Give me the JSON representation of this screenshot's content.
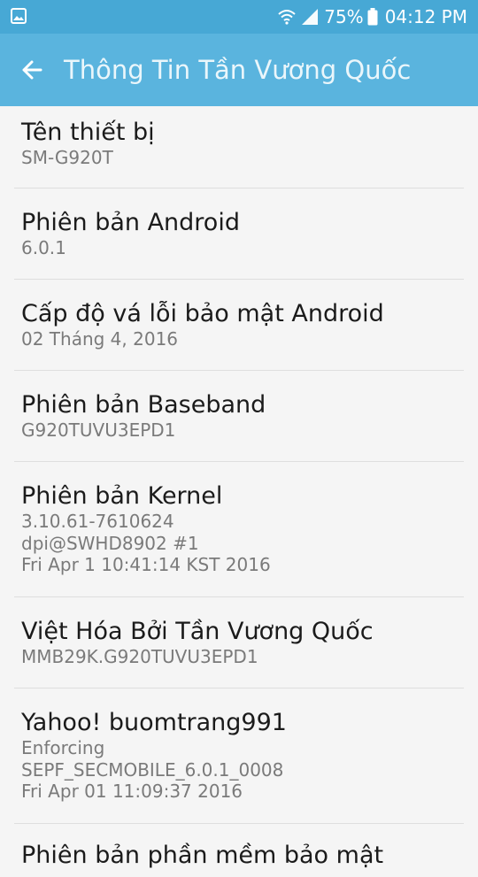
{
  "status_bar": {
    "battery": "75%",
    "time": "04:12 PM",
    "icons": [
      "image-icon",
      "wifi-icon",
      "signal-icon",
      "battery-icon"
    ]
  },
  "app_bar": {
    "title": "Thông Tin Tần Vương Quốc",
    "back_icon": "arrow-left-icon"
  },
  "items": [
    {
      "title": "Tên thiết bị",
      "subs": [
        "SM-G920T"
      ]
    },
    {
      "title": "Phiên bản Android",
      "subs": [
        "6.0.1"
      ]
    },
    {
      "title": "Cấp độ vá lỗi bảo mật Android",
      "subs": [
        "02 Tháng 4, 2016"
      ]
    },
    {
      "title": "Phiên bản Baseband",
      "subs": [
        "G920TUVU3EPD1"
      ]
    },
    {
      "title": "Phiên bản Kernel",
      "subs": [
        "3.10.61-7610624",
        "dpi@SWHD8902 #1",
        "Fri Apr 1 10:41:14 KST 2016"
      ]
    },
    {
      "title": "Việt Hóa Bởi Tần Vương Quốc",
      "subs": [
        "MMB29K.G920TUVU3EPD1"
      ]
    },
    {
      "title": "Yahoo! buomtrang991",
      "subs": [
        "Enforcing",
        "SEPF_SECMOBILE_6.0.1_0008",
        "Fri Apr 01 11:09:37 2016"
      ]
    },
    {
      "title": "Phiên bản phần mềm bảo mật",
      "subs": []
    }
  ]
}
